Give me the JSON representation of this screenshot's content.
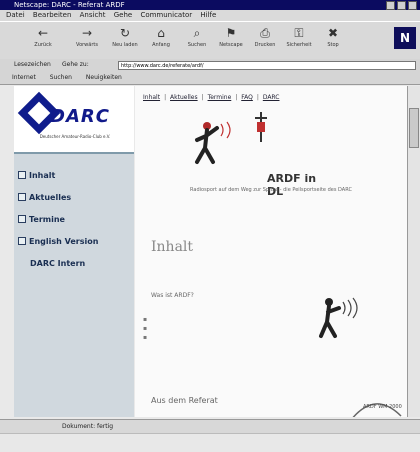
{
  "window": {
    "title": "Netscape: DARC - Referat ARDF"
  },
  "menubar": {
    "items": [
      "Datei",
      "Bearbeiten",
      "Ansicht",
      "Gehe",
      "Communicator",
      "Hilfe"
    ]
  },
  "toolbar": {
    "buttons": [
      {
        "label": "Zurück",
        "icon": "back-icon"
      },
      {
        "label": "Vorwärts",
        "icon": "forward-icon"
      },
      {
        "label": "Neu laden",
        "icon": "reload-icon"
      },
      {
        "label": "Anfang",
        "icon": "home-icon"
      },
      {
        "label": "Suchen",
        "icon": "search-icon"
      },
      {
        "label": "Netscape",
        "icon": "guide-icon"
      },
      {
        "label": "Drucken",
        "icon": "print-icon"
      },
      {
        "label": "Sicherheit",
        "icon": "security-icon"
      },
      {
        "label": "Stop",
        "icon": "stop-icon"
      }
    ],
    "brand_logo": "N"
  },
  "location": {
    "bookmarks_label": "Lesezeichen",
    "goto_label": "Gehe zu:",
    "url": "http://www.darc.de/referate/ardf/"
  },
  "personal_toolbar": {
    "items": [
      "Internet",
      "Suchen",
      "Neuigkeiten"
    ]
  },
  "sidebar": {
    "logo_text": "DARC",
    "logo_subtitle": "Deutscher Amateur-Radio-Club e.V.",
    "items": [
      "Inhalt",
      "Aktuelles",
      "Termine",
      "English Version",
      "DARC Intern"
    ]
  },
  "content": {
    "topnav": [
      "Inhalt",
      "Aktuelles",
      "Termine",
      "FAQ",
      "DARC"
    ],
    "ardf_logo": "ARDF in DL",
    "intro_text": "Radiosport auf dem Weg zur Spitze - die Peilsportseite des DARC",
    "heading": "Inhalt",
    "subheading": "Was ist ARDF?",
    "section_heading": "Aus dem Referat",
    "stamp_text": "ARDF WM 2000"
  },
  "status": {
    "text": "Dokument: fertig"
  },
  "colors": {
    "titlebar": "#0b0b60",
    "darc_blue": "#111a8a",
    "sidebar_bg": "#d0d8de",
    "ardf_red": "#c03030"
  }
}
